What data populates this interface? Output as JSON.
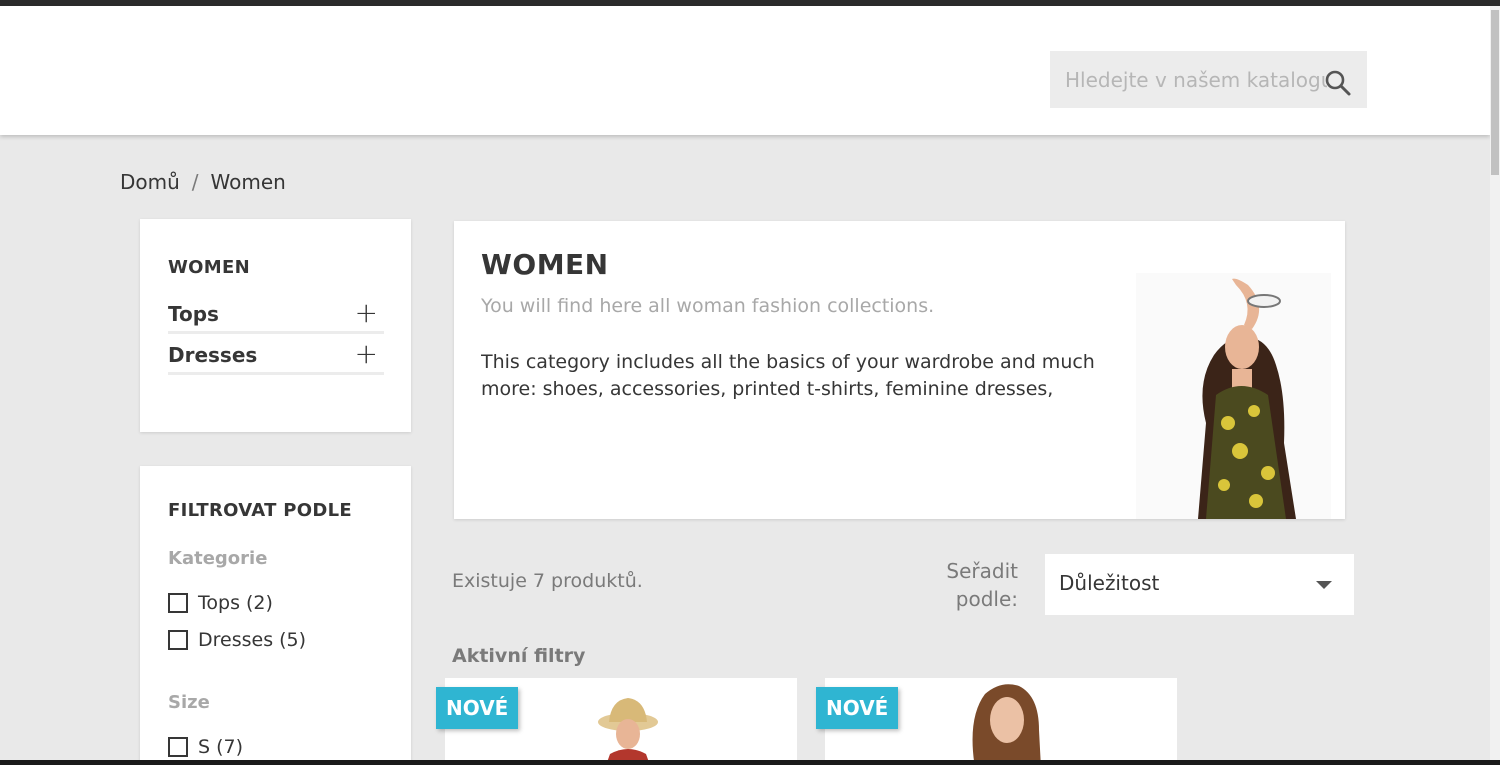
{
  "search": {
    "placeholder": "Hledejte v našem katalogu"
  },
  "breadcrumb": {
    "home": "Domů",
    "separator": "/",
    "current": "Women"
  },
  "category_block": {
    "title": "WOMEN",
    "items": [
      {
        "label": "Tops",
        "expand": "+"
      },
      {
        "label": "Dresses",
        "expand": "+"
      }
    ]
  },
  "filters": {
    "title": "FILTROVAT PODLE",
    "facets": [
      {
        "title": "Kategorie",
        "options": [
          {
            "label": "Tops (2)"
          },
          {
            "label": "Dresses (5)"
          }
        ]
      },
      {
        "title": "Size",
        "options": [
          {
            "label": "S (7)"
          }
        ]
      }
    ]
  },
  "category": {
    "title": "WOMEN",
    "subtitle": "You will find here all woman fashion collections.",
    "description": "This category includes all the basics of your wardrobe and much more: shoes, accessories, printed t-shirts, feminine dresses, women's jeans!"
  },
  "listing": {
    "count_text": "Existuje 7 produktů.",
    "sort_label": "Seřadit podle:",
    "sort_value": "Důležitost",
    "active_filters_label": "Aktivní filtry"
  },
  "products": [
    {
      "badge": "NOVÉ"
    },
    {
      "badge": "NOVÉ"
    }
  ],
  "colors": {
    "accent": "#2fb5d2",
    "background": "#e9e9e9",
    "text": "#363636",
    "muted": "#7a7a7a"
  }
}
